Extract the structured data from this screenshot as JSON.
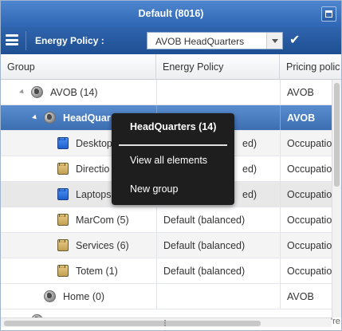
{
  "window": {
    "title": "Default (8016)"
  },
  "toolbar": {
    "energy_policy_label": "Energy Policy :",
    "selected_policy": "AVOB HeadQuarters",
    "menu_icon": "hamburger-menu-icon",
    "apply_icon": "checkmark-icon"
  },
  "grid": {
    "columns": [
      "Group",
      "Energy Policy",
      "Pricing polic"
    ],
    "rows": [
      {
        "name": "AVOB (14)",
        "policy": "",
        "pricing": "AVOB",
        "icon": "globe-icon",
        "expanded": true
      },
      {
        "name": "HeadQuarters (14)",
        "name_visible": "HeadQuar",
        "policy": "",
        "pricing": "AVOB",
        "icon": "globe-icon",
        "expanded": true,
        "selected": true
      },
      {
        "name_visible": "Desktop",
        "policy_visible": "ed)",
        "pricing": "Occupatio",
        "icon": "blue-folder-icon"
      },
      {
        "name_visible": "Directio",
        "policy_visible": "ed)",
        "pricing": "Occupatio",
        "icon": "tan-folder-icon"
      },
      {
        "name_visible": "Laptops",
        "policy_visible": "ed)",
        "pricing": "Occupatio",
        "icon": "blue-folder-icon"
      },
      {
        "name": "MarCom (5)",
        "policy": "Default (balanced)",
        "pricing": "Occupatio",
        "icon": "tan-folder-icon"
      },
      {
        "name": "Services (6)",
        "policy": "Default (balanced)",
        "pricing": "Occupatio",
        "icon": "tan-folder-icon"
      },
      {
        "name": "Totem (1)",
        "policy": "Default (balanced)",
        "pricing": "Occupatio",
        "icon": "tan-folder-icon"
      },
      {
        "name": "Home (0)",
        "policy": "",
        "pricing": "AVOB",
        "icon": "globe-icon"
      }
    ]
  },
  "context_menu": {
    "header": "HeadQuarters (14)",
    "items": [
      "View all elements",
      "New group"
    ]
  },
  "colors": {
    "title_bar": "#2e66b3",
    "toolbar": "#1f4f93",
    "selected_row": "#3c6db2",
    "context_menu": "#1e1e1e"
  },
  "scroll": {
    "corner_text": "'re"
  }
}
